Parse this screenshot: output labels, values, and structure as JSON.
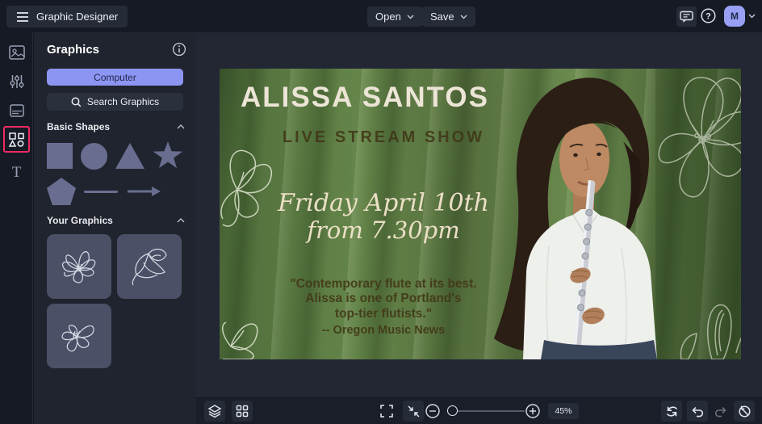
{
  "topbar": {
    "app_title": "Graphic Designer",
    "open_label": "Open",
    "save_label": "Save",
    "avatar_initial": "M"
  },
  "panel": {
    "title": "Graphics",
    "computer_button_label": "Computer",
    "search_label": "Search Graphics",
    "basic_shapes_label": "Basic Shapes",
    "your_graphics_label": "Your Graphics",
    "shape_names": [
      "square",
      "circle",
      "triangle",
      "star",
      "pentagon",
      "line",
      "arrow"
    ],
    "your_graphics_items": [
      "magnolia-line-art-1",
      "magnolia-line-art-2",
      "magnolia-line-art-3"
    ]
  },
  "poster": {
    "headline": "ALISSA SANTOS",
    "subheadline": "LIVE STREAM SHOW",
    "date_line_1": "Friday April 10th",
    "date_line_2": "from 7.30pm",
    "quote_line_1": "\"Contemporary flute at its best.",
    "quote_line_2": "Alissa is one of Portland's",
    "quote_line_3": "top-tier flutists.\"",
    "quote_attribution": "-- Oregon Music News"
  },
  "toolbar": {
    "zoom_value": "45%"
  },
  "icons": {
    "rail": [
      "images-icon",
      "adjustments-icon",
      "templates-icon",
      "shapes-icon",
      "text-icon"
    ],
    "topbar_right": [
      "feedback-icon",
      "help-icon",
      "account-chevron-icon"
    ],
    "bottom": [
      "layers-icon",
      "grid-view-icon",
      "fullscreen-icon",
      "fit-screen-icon",
      "zoom-out-icon",
      "zoom-in-icon",
      "sync-icon",
      "undo-icon",
      "redo-icon",
      "revert-icon"
    ]
  },
  "colors": {
    "accent_purple": "#8d95f2",
    "highlight_pink": "#ee2a62",
    "curtain_green": "#5b7944",
    "headline_cream": "#ece5d6",
    "olive_text": "#4f4627",
    "panel_bg": "#20242e",
    "workspace_bg": "#232734"
  }
}
